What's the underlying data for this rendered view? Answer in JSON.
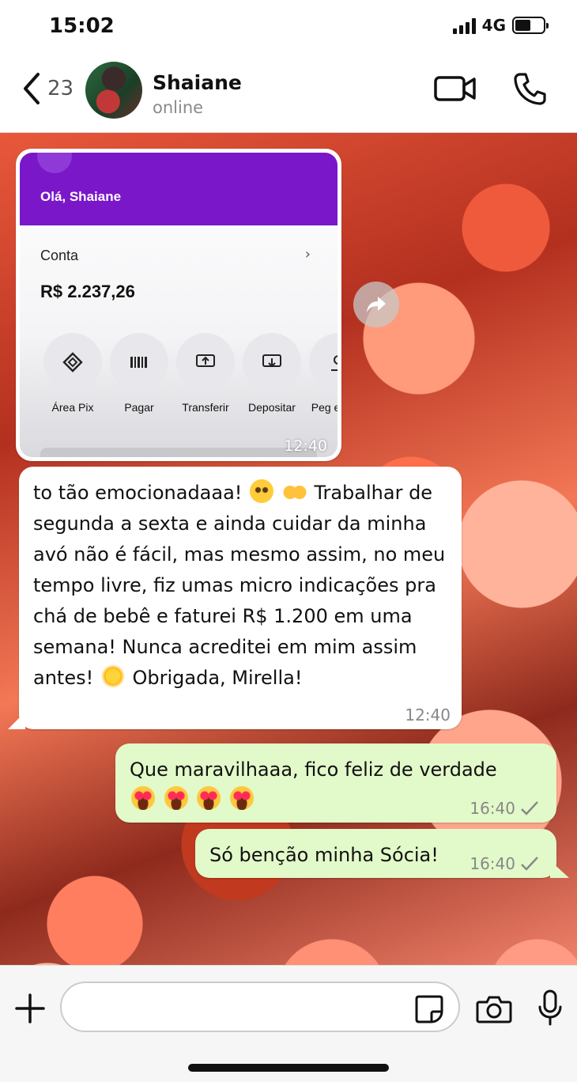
{
  "status_bar": {
    "time": "15:02",
    "network": "4G",
    "battery_level": 0.55
  },
  "header": {
    "back_count": "23",
    "contact_name": "Shaiane",
    "contact_status": "online"
  },
  "messages": {
    "image": {
      "greeting": "Olá, Shaiane",
      "account_label": "Conta",
      "balance": "R$ 2.237,26",
      "actions": [
        "Área Pix",
        "Pagar",
        "Transferir",
        "Depositar",
        "Peg empre"
      ],
      "time": "12:40"
    },
    "incoming": {
      "part1": "to tão emocionadaaa!",
      "part2": "Trabalhar de segunda a sexta e ainda cuidar da minha avó não é fácil, mas mesmo assim, no meu tempo livre, fiz umas micro indicações pra chá de bebê e faturei R$ 1.200 em uma semana! Nunca acreditei em mim assim antes!",
      "part3": "Obrigada, Mirella!",
      "time": "12:40"
    },
    "outgoing1": {
      "text": "Que maravilhaaa, fico feliz de verdade",
      "time": "16:40"
    },
    "outgoing2": {
      "text": "Só benção minha Sócia!",
      "time": "16:40"
    }
  },
  "icons": [
    "back-chevron",
    "video-camera",
    "phone",
    "forward-arrow",
    "plus",
    "sticker",
    "camera",
    "microphone",
    "checkmark"
  ],
  "colors": {
    "bubble_out": "#e2f9c9",
    "bubble_in": "#ffffff",
    "bank_purple": "#7a17c9"
  }
}
